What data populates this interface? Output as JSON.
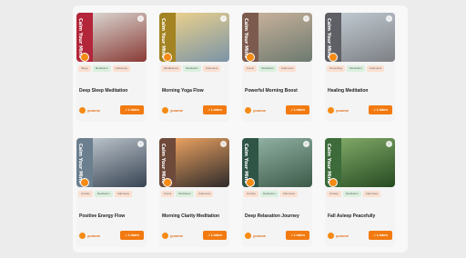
{
  "cards": [
    {
      "band_text": "Calm Your Mind",
      "band_color": "#b3263a",
      "image_colors": [
        "#d9d4cf",
        "#8a3b36"
      ],
      "tags": [
        "Sleep",
        "Meditation",
        "Calmness"
      ],
      "title": "Deep Sleep Meditation",
      "brand": "yumme",
      "listen_label": "Listen"
    },
    {
      "band_text": "Calm Your Mind",
      "band_color": "#a38322",
      "image_colors": [
        "#e8cf8d",
        "#7a94a6"
      ],
      "tags": [
        "Mindfulness",
        "Meditation",
        "Calmness"
      ],
      "title": "Morning Yoga Flow",
      "brand": "yumme",
      "listen_label": "Listen"
    },
    {
      "band_text": "Calm Your Mind",
      "band_color": "#7c5b4e",
      "image_colors": [
        "#c6b09a",
        "#6d7a70"
      ],
      "tags": [
        "Focus",
        "Meditation",
        "Calmness"
      ],
      "title": "Powerful Morning Boost",
      "brand": "yumme",
      "listen_label": "Listen"
    },
    {
      "band_text": "Calm Your Mind",
      "band_color": "#5f5f66",
      "image_colors": [
        "#bfc8cf",
        "#7d8085"
      ],
      "tags": [
        "Grounding",
        "Meditation",
        "Calmness"
      ],
      "title": "Healing Meditation",
      "brand": "yumme",
      "listen_label": "Listen"
    },
    {
      "band_text": "Calm Your Mind",
      "band_color": "#6b7f8f",
      "image_colors": [
        "#b9c1c8",
        "#384454"
      ],
      "tags": [
        "Anxiety",
        "Meditation",
        "Calmness"
      ],
      "title": "Positive Energy Flow",
      "brand": "yumme",
      "listen_label": "Listen"
    },
    {
      "band_text": "Calm Your Mind",
      "band_color": "#6e4a3a",
      "image_colors": [
        "#e8a060",
        "#2d2a2a"
      ],
      "tags": [
        "Focus",
        "Meditation",
        "Calmness"
      ],
      "title": "Morning Clarity Meditation",
      "brand": "yumme",
      "listen_label": "Listen"
    },
    {
      "band_text": "Calm Your Mind",
      "band_color": "#2f5547",
      "image_colors": [
        "#8fb0a2",
        "#3d5a48"
      ],
      "tags": [
        "Anxiety",
        "Meditation",
        "Calmness"
      ],
      "title": "Deep Relaxation Journey",
      "brand": "yumme",
      "listen_label": "Listen"
    },
    {
      "band_text": "Calm Your Mind",
      "band_color": "#3d6b3a",
      "image_colors": [
        "#7fa866",
        "#274a22"
      ],
      "tags": [
        "Anxiety",
        "Meditation",
        "Calmness"
      ],
      "title": "Fall Asleep Peacefully",
      "brand": "yumme",
      "listen_label": "Listen"
    }
  ]
}
